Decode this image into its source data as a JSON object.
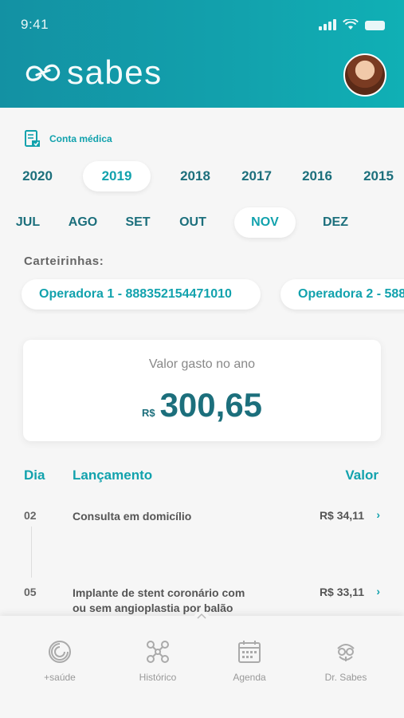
{
  "status_bar": {
    "time": "9:41"
  },
  "app": {
    "brand": "sabes",
    "icons": {
      "logo": "infinity-logo-icon",
      "avatar": "user-avatar"
    }
  },
  "section": {
    "label": "Conta médica",
    "icon": "medical-bill-icon"
  },
  "years": [
    {
      "label": "2020",
      "selected": false
    },
    {
      "label": "2019",
      "selected": true
    },
    {
      "label": "2018",
      "selected": false
    },
    {
      "label": "2017",
      "selected": false
    },
    {
      "label": "2016",
      "selected": false
    },
    {
      "label": "2015",
      "selected": false
    }
  ],
  "months": [
    {
      "label": "JUL",
      "selected": false
    },
    {
      "label": "AGO",
      "selected": false
    },
    {
      "label": "SET",
      "selected": false
    },
    {
      "label": "OUT",
      "selected": false
    },
    {
      "label": "NOV",
      "selected": true
    },
    {
      "label": "DEZ",
      "selected": false
    }
  ],
  "carteirinhas": {
    "label": "Carteirinhas:",
    "cards": [
      {
        "label": "Operadora 1 - 888352154471010"
      },
      {
        "label": "Operadora 2 - 588"
      }
    ]
  },
  "summary": {
    "caption": "Valor gasto no ano",
    "currency": "R$",
    "value": "300,65"
  },
  "table": {
    "headers": {
      "day": "Dia",
      "entry": "Lançamento",
      "value": "Valor"
    },
    "rows": [
      {
        "day": "02",
        "description": "Consulta em domicílio",
        "value": "R$ 34,11",
        "chevron": "›"
      },
      {
        "day": "05",
        "description": "Implante de stent coronário com ou sem angioplastia por balão",
        "value": "R$ 33,11",
        "chevron": "›"
      }
    ]
  },
  "bottom_nav": [
    {
      "label": "+saúde",
      "icon": "health-ring-icon"
    },
    {
      "label": "Histórico",
      "icon": "history-network-icon"
    },
    {
      "label": "Agenda",
      "icon": "calendar-icon"
    },
    {
      "label": "Dr. Sabes",
      "icon": "doctor-robot-icon"
    }
  ],
  "colors": {
    "primary": "#12a2ad",
    "dark": "#1c6f7c",
    "background": "#f6f6f6"
  }
}
